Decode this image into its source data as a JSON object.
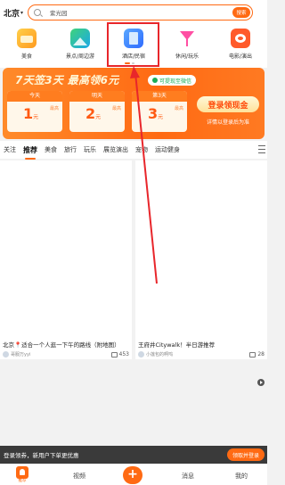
{
  "topbar": {
    "city": "北京",
    "search_placeholder": "紫光园",
    "search_button": "搜索"
  },
  "categories": [
    {
      "label": "美食",
      "icon": "food-icon"
    },
    {
      "label": "景点/周边游",
      "icon": "scenic-icon"
    },
    {
      "label": "酒店/民宿",
      "icon": "hotel-icon"
    },
    {
      "label": "休闲/玩乐",
      "icon": "cocktail-icon"
    },
    {
      "label": "电影/演出",
      "icon": "movie-icon"
    }
  ],
  "promo": {
    "headline": "7天签3天  最高领6元",
    "wechat_note": "可提现至微信",
    "days": [
      {
        "label": "今天",
        "amount": "1",
        "unit": "元",
        "tag": "最高"
      },
      {
        "label": "明天",
        "amount": "2",
        "unit": "元",
        "tag": "最高"
      },
      {
        "label": "第3天",
        "amount": "3",
        "unit": "元",
        "tag": "最高"
      }
    ],
    "claim_button": "登录领现金",
    "claim_sub": "详情以登录后为准"
  },
  "tabs": [
    "关注",
    "推荐",
    "美食",
    "旅行",
    "玩乐",
    "展览演出",
    "宠物",
    "运动健身"
  ],
  "active_tab": "推荐",
  "feed": [
    {
      "title": "北京📍适合一个人逛一下午的路线（附地图）",
      "user": "哥服万yyi",
      "likes": "453"
    },
    {
      "title": "王府井Citywalk！半日游推荐",
      "user": "小莲包的啊呜",
      "likes": "28"
    }
  ],
  "signup": {
    "text": "登录领券，新用户下单更优惠",
    "button": "领取并登录"
  },
  "nav": {
    "home": "推荐",
    "video": "视频",
    "plus": "+",
    "messages": "消息",
    "me": "我的"
  },
  "colors": {
    "accent": "#ff6a13",
    "highlight": "#e8262b"
  }
}
